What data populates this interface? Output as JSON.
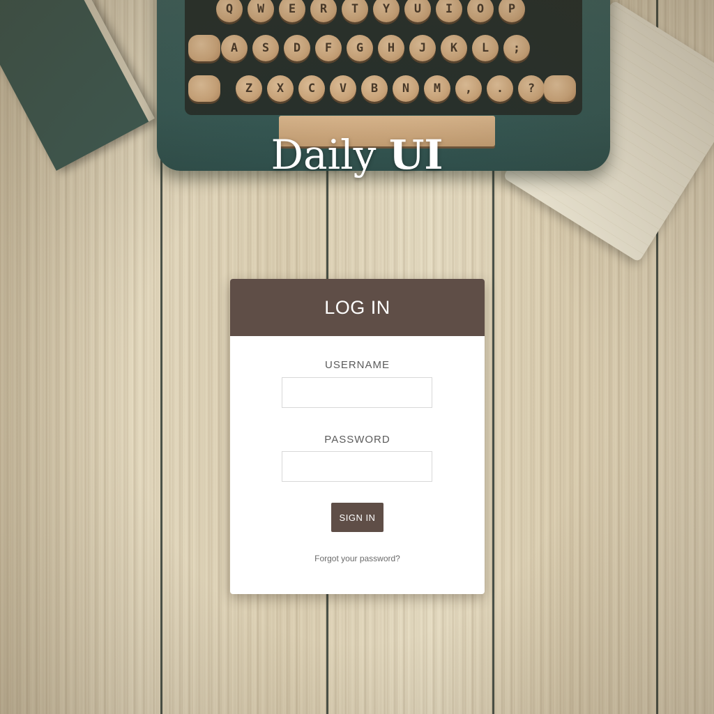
{
  "background": {
    "typewriter_keys_row1": [
      "Q",
      "W",
      "E",
      "R",
      "T",
      "Y",
      "U",
      "I",
      "O",
      "P"
    ],
    "typewriter_keys_row2": [
      "A",
      "S",
      "D",
      "F",
      "G",
      "H",
      "J",
      "K",
      "L",
      ";"
    ],
    "typewriter_keys_row3": [
      "Z",
      "X",
      "C",
      "V",
      "B",
      "N",
      "M",
      ",",
      ".",
      "?"
    ]
  },
  "brand": {
    "light": "Daily ",
    "bold": "UI"
  },
  "login": {
    "title": "LOG IN",
    "username_label": "USERNAME",
    "username_value": "",
    "password_label": "PASSWORD",
    "password_value": "",
    "submit_label": "SIGN IN",
    "forgot_link": "Forgot your password?"
  },
  "colors": {
    "accent": "#5f4e47",
    "card_bg": "#ffffff",
    "typewriter": "#3f6460"
  }
}
